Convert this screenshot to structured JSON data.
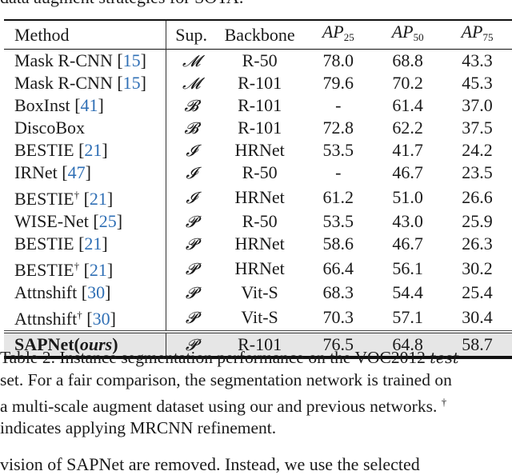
{
  "top_fragment": "data augment strategies for SOTA.",
  "table": {
    "headers": {
      "method": "Method",
      "sup": "Sup.",
      "backbone": "Backbone",
      "ap25_base": "AP",
      "ap25_sub": "25",
      "ap50_base": "AP",
      "ap50_sub": "50",
      "ap75_base": "AP",
      "ap75_sub": "75"
    },
    "rows": [
      {
        "method": "Mask R-CNN ",
        "dagger": "",
        "cite": "15",
        "sup": "𝓜",
        "backbone": "R-50",
        "ap25": "78.0",
        "ap50": "68.8",
        "ap75": "43.3"
      },
      {
        "method": "Mask R-CNN ",
        "dagger": "",
        "cite": "15",
        "sup": "𝓜",
        "backbone": "R-101",
        "ap25": "79.6",
        "ap50": "70.2",
        "ap75": "45.3"
      },
      {
        "method": "BoxInst ",
        "dagger": "",
        "cite": "41",
        "sup": "𝓑",
        "backbone": "R-101",
        "ap25": "-",
        "ap50": "61.4",
        "ap75": "37.0"
      },
      {
        "method": "DiscoBox",
        "dagger": "",
        "cite": "",
        "sup": "𝓑",
        "backbone": "R-101",
        "ap25": "72.8",
        "ap50": "62.2",
        "ap75": "37.5"
      },
      {
        "method": "BESTIE ",
        "dagger": "",
        "cite": "21",
        "sup": "𝓘",
        "backbone": "HRNet",
        "ap25": "53.5",
        "ap50": "41.7",
        "ap75": "24.2"
      },
      {
        "method": "IRNet ",
        "dagger": "",
        "cite": "47",
        "sup": "𝓘",
        "backbone": "R-50",
        "ap25": "-",
        "ap50": "46.7",
        "ap75": "23.5"
      },
      {
        "method": "BESTIE",
        "dagger": "†",
        "cite": "21",
        "sup": "𝓘",
        "backbone": "HRNet",
        "ap25": "61.2",
        "ap50": "51.0",
        "ap75": "26.6"
      },
      {
        "method": "WISE-Net ",
        "dagger": "",
        "cite": "25",
        "sup": "𝓟",
        "backbone": "R-50",
        "ap25": "53.5",
        "ap50": "43.0",
        "ap75": "25.9"
      },
      {
        "method": "BESTIE ",
        "dagger": "",
        "cite": "21",
        "sup": "𝓟",
        "backbone": "HRNet",
        "ap25": "58.6",
        "ap50": "46.7",
        "ap75": "26.3"
      },
      {
        "method": "BESTIE",
        "dagger": "†",
        "cite": "21",
        "sup": "𝓟",
        "backbone": "HRNet",
        "ap25": "66.4",
        "ap50": "56.1",
        "ap75": "30.2"
      },
      {
        "method": "Attnshift ",
        "dagger": "",
        "cite": "30",
        "sup": "𝓟",
        "backbone": "Vit-S",
        "ap25": "68.3",
        "ap50": "54.4",
        "ap75": "25.4"
      },
      {
        "method": "Attnshift",
        "dagger": "†",
        "cite": "30",
        "sup": "𝓟",
        "backbone": "Vit-S",
        "ap25": "70.3",
        "ap50": "57.1",
        "ap75": "30.4"
      }
    ],
    "ours": {
      "method": "SAPNet",
      "method_suffix": "ours",
      "sup": "𝓟",
      "backbone": "R-101",
      "ap25": "76.5",
      "ap50": "64.8",
      "ap75": "58.7"
    }
  },
  "caption": {
    "line1_a": "Table 2.  Instance segmentation performance on the VOC2012 ",
    "line1_em": "test",
    "line2": "set. For a fair comparison, the segmentation network is trained on",
    "line3": "a multi-scale augment dataset using our and previous networks.  ",
    "line3_dagger": "†",
    "line4": "indicates applying MRCNN refinement."
  },
  "bottom_fragment": "vision of SAPNet are removed. Instead, we use the selected"
}
